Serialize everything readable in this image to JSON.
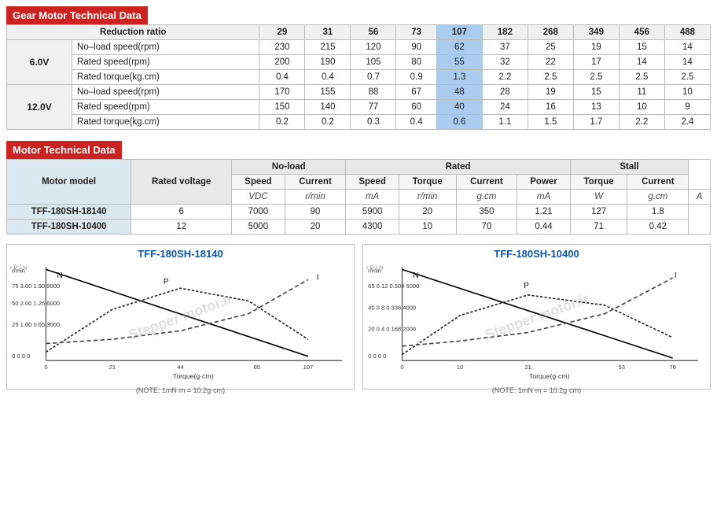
{
  "gear_section": {
    "title": "Gear Motor Technical Data",
    "ratio_label": "Reduction ratio",
    "ratios": [
      29,
      31,
      56,
      73,
      107,
      182,
      268,
      349,
      456,
      488
    ],
    "voltages": [
      {
        "label": "6.0V",
        "rows": [
          {
            "name": "No–load speed(rpm)",
            "values": [
              230,
              215,
              120,
              90,
              62,
              37,
              25,
              19,
              15,
              14
            ]
          },
          {
            "name": "Rated speed(rpm)",
            "values": [
              200,
              190,
              105,
              80,
              55,
              32,
              22,
              17,
              14,
              14
            ]
          },
          {
            "name": "Rated torque(kg.cm)",
            "values": [
              0.4,
              0.4,
              0.7,
              0.9,
              1.3,
              2.2,
              2.5,
              2.5,
              2.5,
              2.5
            ]
          }
        ]
      },
      {
        "label": "12.0V",
        "rows": [
          {
            "name": "No–load speed(rpm)",
            "values": [
              170,
              155,
              88,
              67,
              48,
              28,
              19,
              15,
              11,
              10
            ]
          },
          {
            "name": "Rated speed(rpm)",
            "values": [
              150,
              140,
              77,
              60,
              40,
              24,
              16,
              13,
              10,
              9
            ]
          },
          {
            "name": "Rated torque(kg.cm)",
            "values": [
              0.2,
              0.2,
              0.3,
              0.4,
              0.6,
              1.1,
              1.5,
              1.7,
              2.2,
              2.4
            ]
          }
        ]
      }
    ],
    "highlight_col": 4
  },
  "motor_section": {
    "title": "Motor Technical Data",
    "headers": {
      "motor_model": "Motor model",
      "rated_voltage": "Rated voltage",
      "no_load": "No-load",
      "rated": "Rated",
      "stall": "Stall",
      "speed": "Speed",
      "current": "Current",
      "torque": "Torque",
      "power": "Power"
    },
    "units": {
      "vdc": "VDC",
      "rmin": "r/min",
      "ma": "mA",
      "gcm": "g.cm",
      "w": "W",
      "a": "A"
    },
    "models": [
      {
        "name": "TFF-180SH-18140",
        "rated_voltage": 6.0,
        "no_load_speed": 7000,
        "no_load_current": 90,
        "rated_speed": 5900,
        "rated_torque": 20,
        "rated_current": 350,
        "rated_power": 1.21,
        "stall_torque": 127,
        "stall_current": 1.8
      },
      {
        "name": "TFF-180SH-10400",
        "rated_voltage": 12.0,
        "no_load_speed": 5000,
        "no_load_current": 20,
        "rated_speed": 4300,
        "rated_torque": 10,
        "rated_current": 70,
        "rated_power": 0.44,
        "stall_torque": 71,
        "stall_current": 0.42
      }
    ]
  },
  "charts": [
    {
      "id": "chart1",
      "title": "TFF-180SH-18140",
      "x_label": "Torque(g·cm)",
      "x_max": 127,
      "note": "(NOTE: 1mN·m = 10.2g·cm)",
      "y_left_labels": [
        "r/min",
        "P",
        "I",
        "N"
      ],
      "x_axis_labels": [
        "0",
        "21",
        "44",
        "85",
        "107"
      ],
      "curves": {
        "speed": {
          "color": "#000",
          "label": "N"
        },
        "power": {
          "color": "#000",
          "label": "P"
        },
        "current": {
          "color": "#000",
          "label": "I"
        }
      }
    },
    {
      "id": "chart2",
      "title": "TFF-180SH-10400",
      "x_label": "Torque(g·cm)",
      "x_max": 71,
      "note": "(NOTE: 1mN·m = 10.2g·cm)",
      "y_left_labels": [
        "r/min",
        "P",
        "I",
        "N"
      ],
      "x_axis_labels": [
        "0",
        "10",
        "21",
        "53",
        "76"
      ],
      "curves": {
        "speed": {
          "color": "#000",
          "label": "N"
        },
        "power": {
          "color": "#000",
          "label": "P"
        },
        "current": {
          "color": "#000",
          "label": "I"
        }
      }
    }
  ],
  "watermark": "Stepper motor.ir"
}
